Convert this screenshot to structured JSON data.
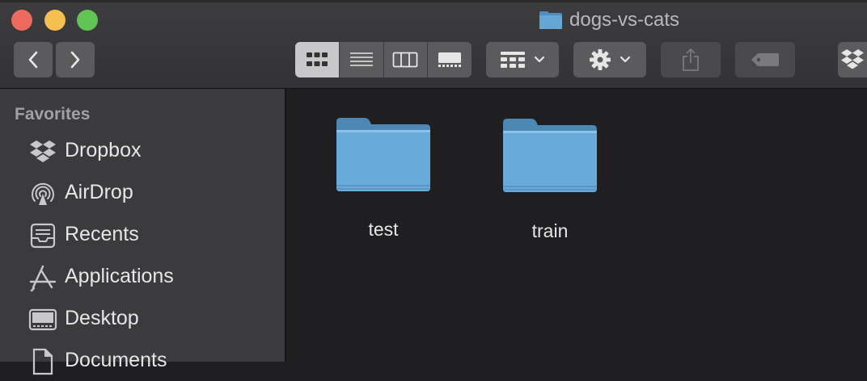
{
  "window": {
    "title": "dogs-vs-cats",
    "title_icon": "folder-icon",
    "accent_folder_color": "#64a7d6"
  },
  "toolbar": {
    "back_icon": "chevron-left-icon",
    "forward_icon": "chevron-right-icon",
    "view_modes": [
      {
        "icon": "icon-view-icon",
        "selected": true
      },
      {
        "icon": "list-view-icon",
        "selected": false
      },
      {
        "icon": "column-view-icon",
        "selected": false
      },
      {
        "icon": "gallery-view-icon",
        "selected": false
      }
    ],
    "group_icon": "group-by-icon",
    "action_icon": "gear-icon",
    "share_icon": "share-icon",
    "tag_icon": "tag-icon",
    "dropbox_icon": "dropbox-icon"
  },
  "sidebar": {
    "heading": "Favorites",
    "items": [
      {
        "label": "Dropbox",
        "icon": "dropbox-icon"
      },
      {
        "label": "AirDrop",
        "icon": "airdrop-icon"
      },
      {
        "label": "Recents",
        "icon": "recents-icon"
      },
      {
        "label": "Applications",
        "icon": "applications-icon"
      },
      {
        "label": "Desktop",
        "icon": "desktop-icon"
      },
      {
        "label": "Documents",
        "icon": "documents-icon"
      }
    ]
  },
  "content": {
    "items": [
      {
        "name": "test",
        "type": "folder"
      },
      {
        "name": "train",
        "type": "folder"
      }
    ]
  }
}
